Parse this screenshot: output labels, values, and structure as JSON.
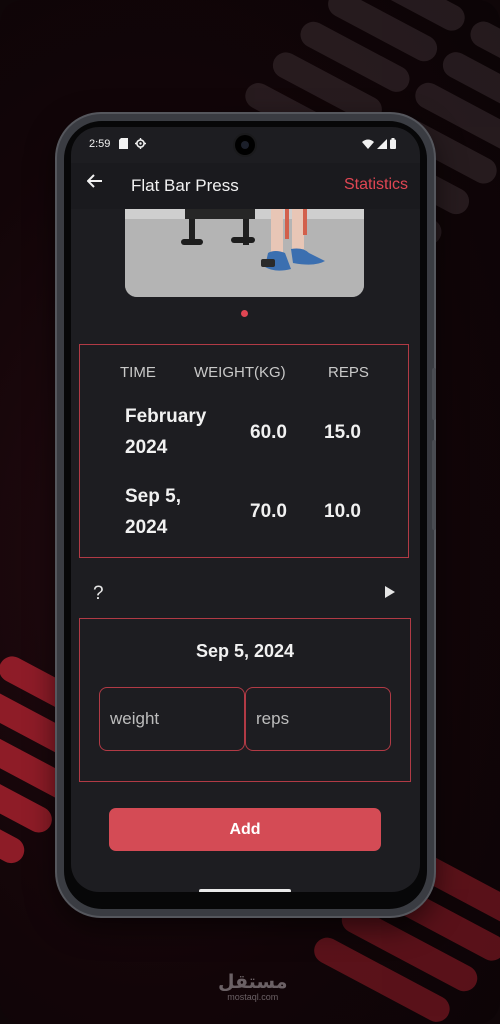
{
  "status_bar": {
    "time": "2:59"
  },
  "app_bar": {
    "title": "Flat Bar Press",
    "statistics_label": "Statistics"
  },
  "history_table": {
    "headers": [
      "TIME",
      "WEIGHT(KG)",
      "REPS"
    ],
    "rows": [
      {
        "time": "February 2024",
        "weight": "60.0",
        "reps": "15.0"
      },
      {
        "time": "Sep 5, 2024",
        "weight": "70.0",
        "reps": "10.0"
      }
    ]
  },
  "help_symbol": "?",
  "entry": {
    "date": "Sep 5, 2024",
    "weight_placeholder": "weight",
    "reps_placeholder": "reps",
    "add_label": "Add"
  },
  "brand": {
    "arabic": "مستقل",
    "latin": "mostaql.com"
  },
  "colors": {
    "accent": "#e04653",
    "button": "#d44b55",
    "card_border": "#b13a45",
    "background": "#1d1d21"
  },
  "icons": [
    "back-arrow-icon",
    "sd-card-icon",
    "settings-gear-icon",
    "wifi-icon",
    "signal-icon",
    "battery-icon",
    "help-icon",
    "play-icon"
  ]
}
